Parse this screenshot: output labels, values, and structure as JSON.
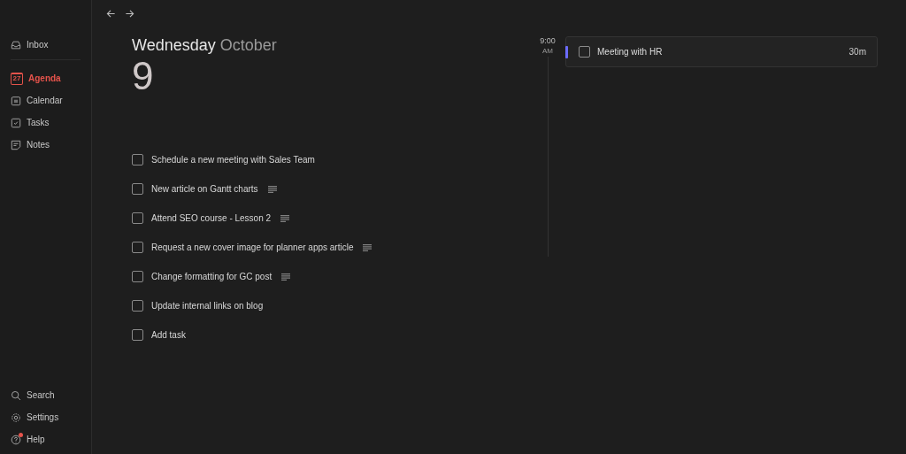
{
  "sidebar": {
    "top_items": [
      {
        "kind": "inbox",
        "label": "Inbox",
        "selected": false
      }
    ],
    "items": [
      {
        "kind": "agenda",
        "label": "Agenda",
        "selected": true,
        "icon_text": "27"
      },
      {
        "kind": "calendar",
        "label": "Calendar",
        "selected": false
      },
      {
        "kind": "tasks",
        "label": "Tasks",
        "selected": false
      },
      {
        "kind": "notes",
        "label": "Notes",
        "selected": false
      }
    ],
    "bottom_items": [
      {
        "kind": "search",
        "label": "Search",
        "selected": false,
        "badge": false
      },
      {
        "kind": "settings",
        "label": "Settings",
        "selected": false,
        "badge": false
      },
      {
        "kind": "help",
        "label": "Help",
        "selected": false,
        "badge": true
      }
    ]
  },
  "day": {
    "weekday": "Wednesday",
    "month": "October",
    "date": "9"
  },
  "tasks": [
    {
      "title": "Schedule a new meeting with Sales Team",
      "checked": false,
      "has_notes": false
    },
    {
      "title": "New article on Gantt charts",
      "checked": false,
      "has_notes": true
    },
    {
      "title": "Attend SEO course - Lesson 2",
      "checked": false,
      "has_notes": true
    },
    {
      "title": "Request a new cover image for planner apps article",
      "checked": false,
      "has_notes": true
    },
    {
      "title": "Change formatting for GC post",
      "checked": false,
      "has_notes": true
    },
    {
      "title": "Update internal links on blog",
      "checked": false,
      "has_notes": false
    }
  ],
  "add_task": {
    "label": "Add task",
    "checked": false
  },
  "timeline": {
    "time": "9:00",
    "period": "AM",
    "events": [
      {
        "title": "Meeting with HR",
        "duration": "30m",
        "checked": false,
        "color": "#6b6bff"
      }
    ]
  }
}
